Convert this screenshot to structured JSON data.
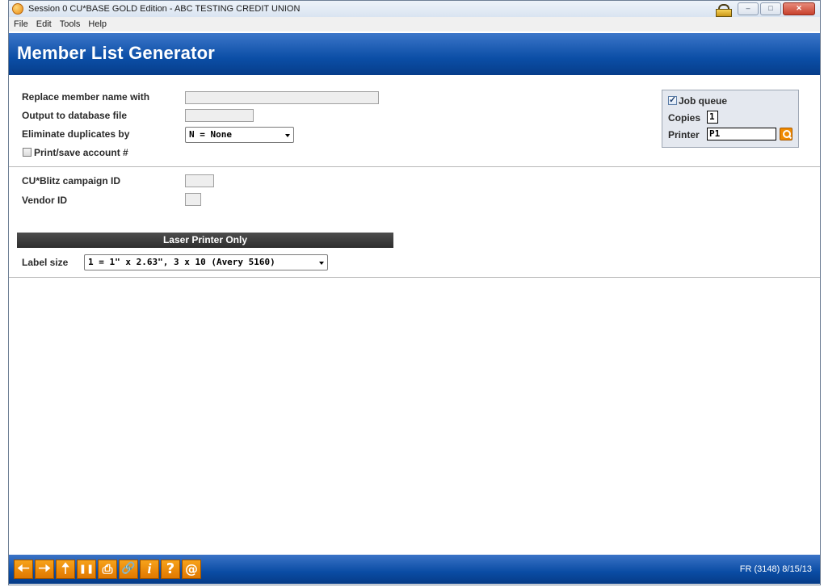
{
  "window": {
    "title": "Session 0 CU*BASE GOLD Edition - ABC TESTING CREDIT UNION",
    "minimize": "–",
    "maximize": "□",
    "close": "✕"
  },
  "menu": [
    "File",
    "Edit",
    "Tools",
    "Help"
  ],
  "page_title": "Member List Generator",
  "form": {
    "replace_name_label": "Replace member name with",
    "replace_name_value": "",
    "output_db_label": "Output to database file",
    "output_db_value": "",
    "eliminate_dups_label": "Eliminate duplicates by",
    "eliminate_dups_value": "N = None",
    "print_save_label": "Print/save account #",
    "print_save_checked": false,
    "campaign_label": "CU*Blitz campaign ID",
    "campaign_value": "",
    "vendor_label": "Vendor ID",
    "vendor_value": ""
  },
  "job": {
    "job_queue_label": "Job queue",
    "job_queue_checked": true,
    "copies_label": "Copies",
    "copies_value": "1",
    "printer_label": "Printer",
    "printer_value": "P1"
  },
  "laser": {
    "section_title": "Laser Printer Only",
    "label_size_label": "Label size",
    "label_size_value": "1 = 1\" x 2.63\", 3 x 10 (Avery 5160)"
  },
  "footer": {
    "buttons": [
      {
        "name": "back-arrow-icon",
        "glyph": "🠠"
      },
      {
        "name": "forward-arrow-icon",
        "glyph": "🠢"
      },
      {
        "name": "up-arrow-icon",
        "glyph": "🠡"
      },
      {
        "name": "pause-icon",
        "glyph": "❚❚"
      },
      {
        "name": "print-icon",
        "glyph": "⎙"
      },
      {
        "name": "link-icon",
        "glyph": "🔗"
      },
      {
        "name": "info-icon",
        "glyph": "i"
      },
      {
        "name": "help-icon",
        "glyph": "?"
      },
      {
        "name": "at-icon",
        "glyph": "@"
      }
    ],
    "version": "FR (3148) 8/15/13"
  },
  "colors": {
    "header_blue": "#0b4ea6",
    "button_orange": "#f08a00",
    "section_dark": "#3a3a3a"
  }
}
